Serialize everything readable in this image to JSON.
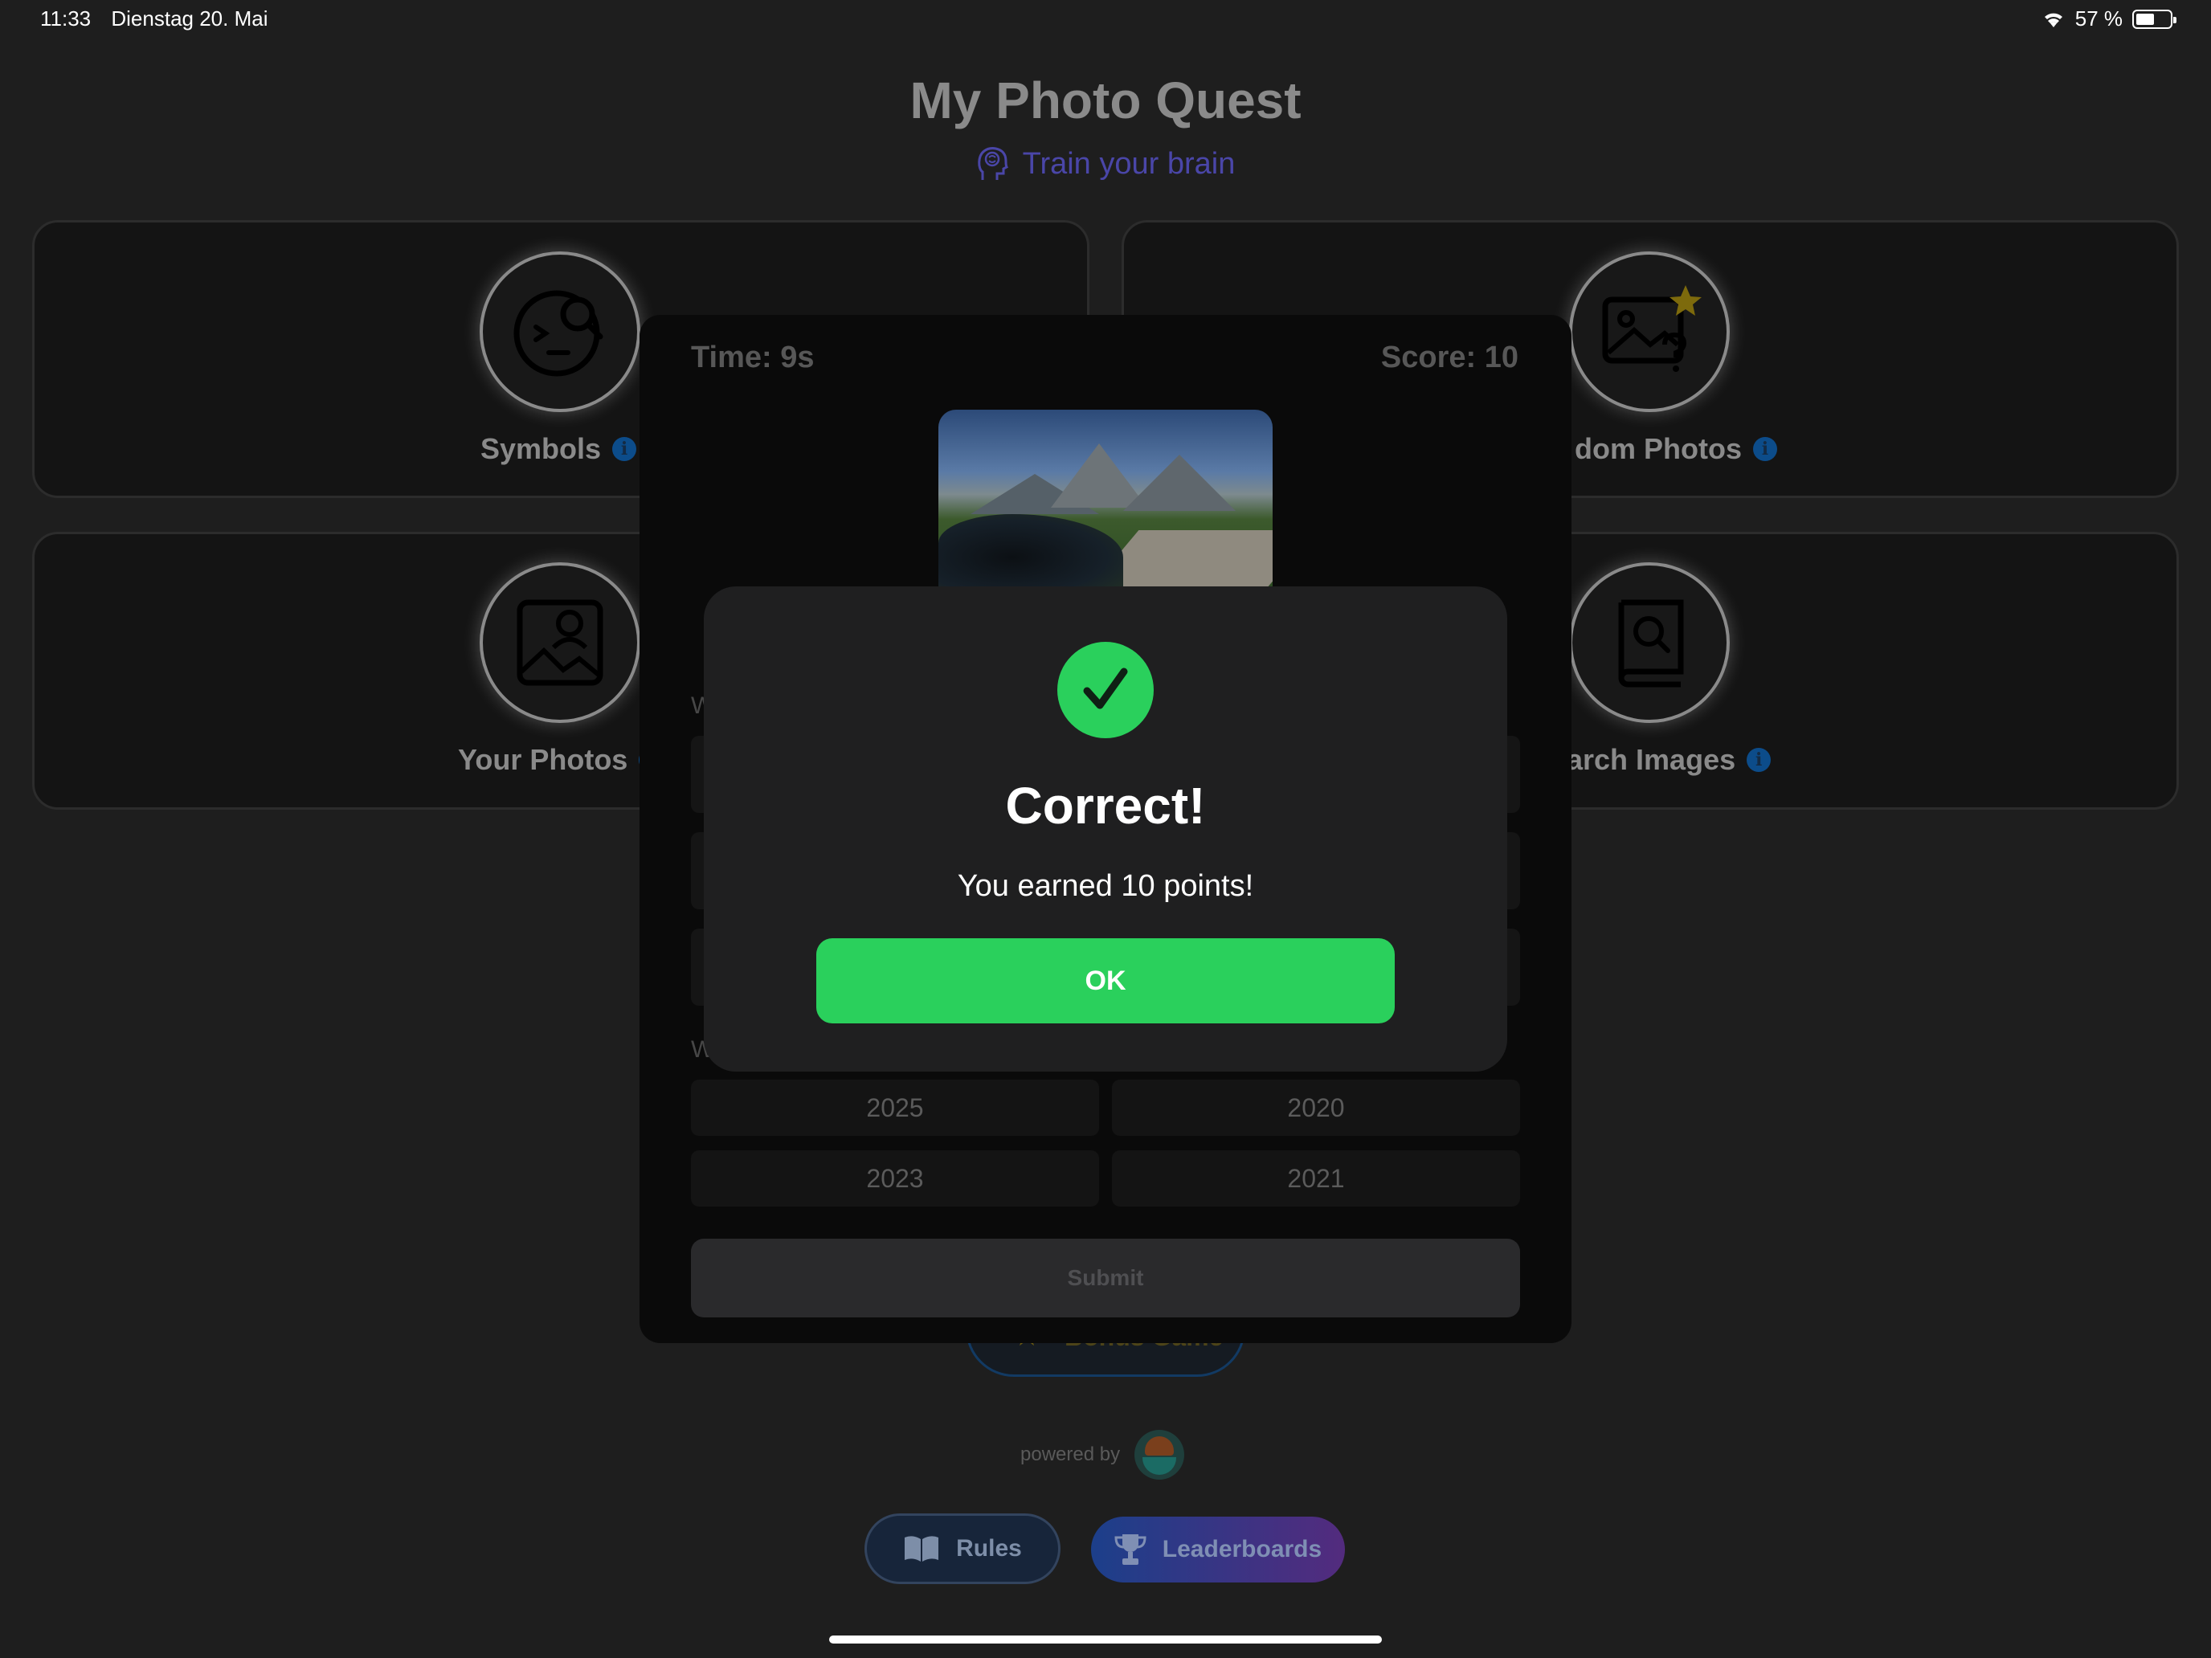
{
  "status_bar": {
    "time": "11:33",
    "date": "Dienstag 20. Mai",
    "battery_percent": "57 %",
    "battery_level": 0.57
  },
  "header": {
    "title": "My Photo Quest",
    "tagline": "Train your brain",
    "tagline_icon": "brain-head-icon"
  },
  "modes": [
    {
      "label": "Symbols",
      "icon": "face-search-icon"
    },
    {
      "label": "dom Photos",
      "icon": "image-question-star-icon"
    },
    {
      "label": "Your Photos",
      "icon": "image-person-icon"
    },
    {
      "label": "arch Images",
      "icon": "book-search-icon"
    }
  ],
  "bonus": {
    "label": "Bonus Game",
    "icon": "star-icon"
  },
  "powered_by": "powered by",
  "bottom_buttons": {
    "rules": "Rules",
    "leaderboards": "Leaderboards"
  },
  "game": {
    "time_label": "Time: 9s",
    "score_label": "Score: 10",
    "q1_hint": "W",
    "q2_hint": "W",
    "year_options": [
      "2025",
      "2020",
      "2023",
      "2021"
    ],
    "submit_label": "Submit"
  },
  "alert": {
    "title": "Correct!",
    "message": "You earned 10 points!",
    "ok_label": "OK"
  },
  "colors": {
    "success": "#2ad05c",
    "background": "#1e1e1e",
    "alert_bg": "#1f1f20"
  }
}
